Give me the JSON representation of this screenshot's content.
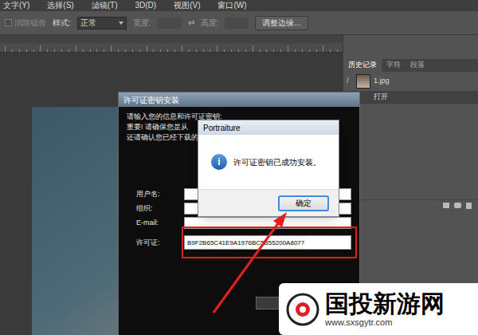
{
  "menu_bar": [
    "文字(Y)",
    "选择(S)",
    "滤镜(T)",
    "3D(D)",
    "视图(V)",
    "窗口(W)"
  ],
  "options_bar": {
    "anti_alias": {
      "label": "消除锯齿",
      "checked": false,
      "disabled": true
    },
    "style_label": "样式:",
    "style_value": "正常",
    "width_label": "宽度:",
    "swap": "⇄",
    "height_label": "高度:",
    "refine_button": "调整边缘..."
  },
  "history_panel": {
    "tabs": [
      {
        "label": "历史记录",
        "selected": true
      },
      {
        "label": "字符",
        "selected": false
      },
      {
        "label": "段落",
        "selected": false
      }
    ],
    "items": [
      {
        "label": "1.jpg",
        "kind": "snapshot",
        "selected": false
      },
      {
        "label": "打开",
        "kind": "step",
        "selected": true
      }
    ]
  },
  "license_dialog": {
    "title": "许可证密钥安装",
    "intro": "请输入您的信息和许可证密钥:",
    "notes": [
      "重要! 请确保您是从",
      "还请确认您已经下载的"
    ],
    "fields": [
      {
        "label": "用户名:",
        "value": "",
        "highlighted": false
      },
      {
        "label": "组织:",
        "value": "",
        "highlighted": false
      },
      {
        "label": "E-mail:",
        "value": "",
        "highlighted": false
      },
      {
        "label": "许可证:",
        "value": "B9F2B65C41E9A1976BC5B55200A8077",
        "highlighted": true
      }
    ]
  },
  "message_box": {
    "title": "Portraiture",
    "icon": "i",
    "message": "许可证密钥已成功安装。",
    "buttons": [
      {
        "label": "确定",
        "focused": true
      }
    ]
  },
  "watermark": {
    "name": "国投新游网",
    "url": "www.sxsgytr.com"
  }
}
